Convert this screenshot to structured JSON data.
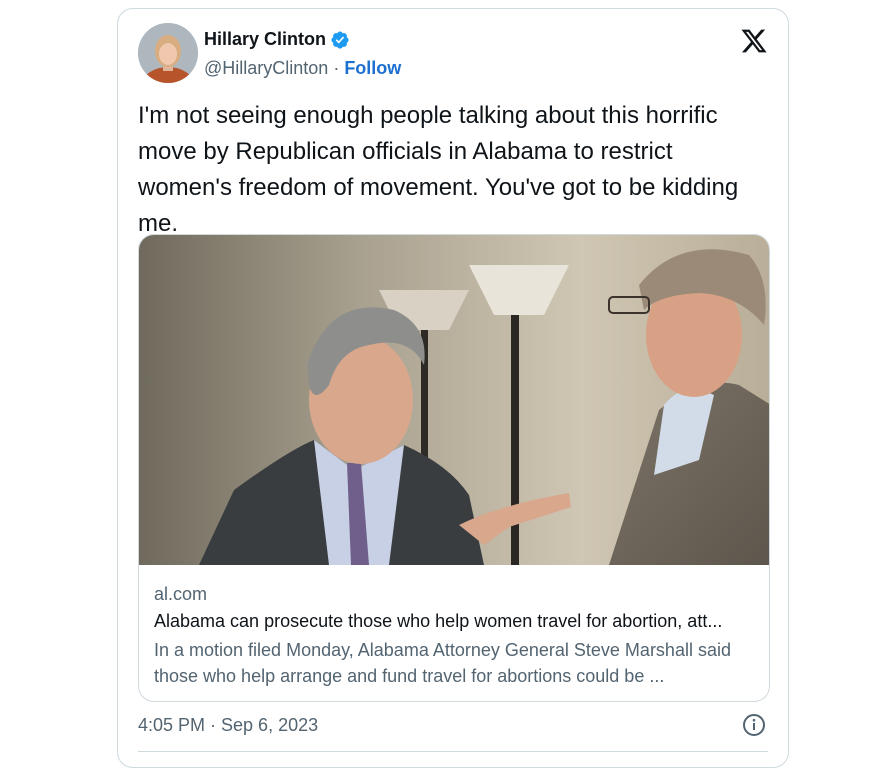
{
  "author": {
    "name": "Hillary Clinton",
    "handle": "@HillaryClinton",
    "separator": "·",
    "follow_label": "Follow"
  },
  "tweet": {
    "text": "I'm not seeing enough people talking about this horrific move by Republican officials in Alabama to restrict women's freedom of movement. You've got to be kidding me.",
    "timestamp": "4:05 PM · Sep 6, 2023"
  },
  "link_card": {
    "domain": "al.com",
    "headline": "Alabama can prosecute those who help women travel for abortion, att...",
    "description": "In a motion filed Monday, Alabama Attorney General Steve Marshall said those who help arrange and fund travel for abortions could be ..."
  },
  "icons": {
    "verified": "verified-badge-icon",
    "brand": "x-logo-icon",
    "info": "info-icon"
  },
  "colors": {
    "verified_blue": "#1d9bf0",
    "follow_blue": "#1d6fd0",
    "text_primary": "#0f1419",
    "text_secondary": "#536471",
    "border": "#cfd9de"
  }
}
